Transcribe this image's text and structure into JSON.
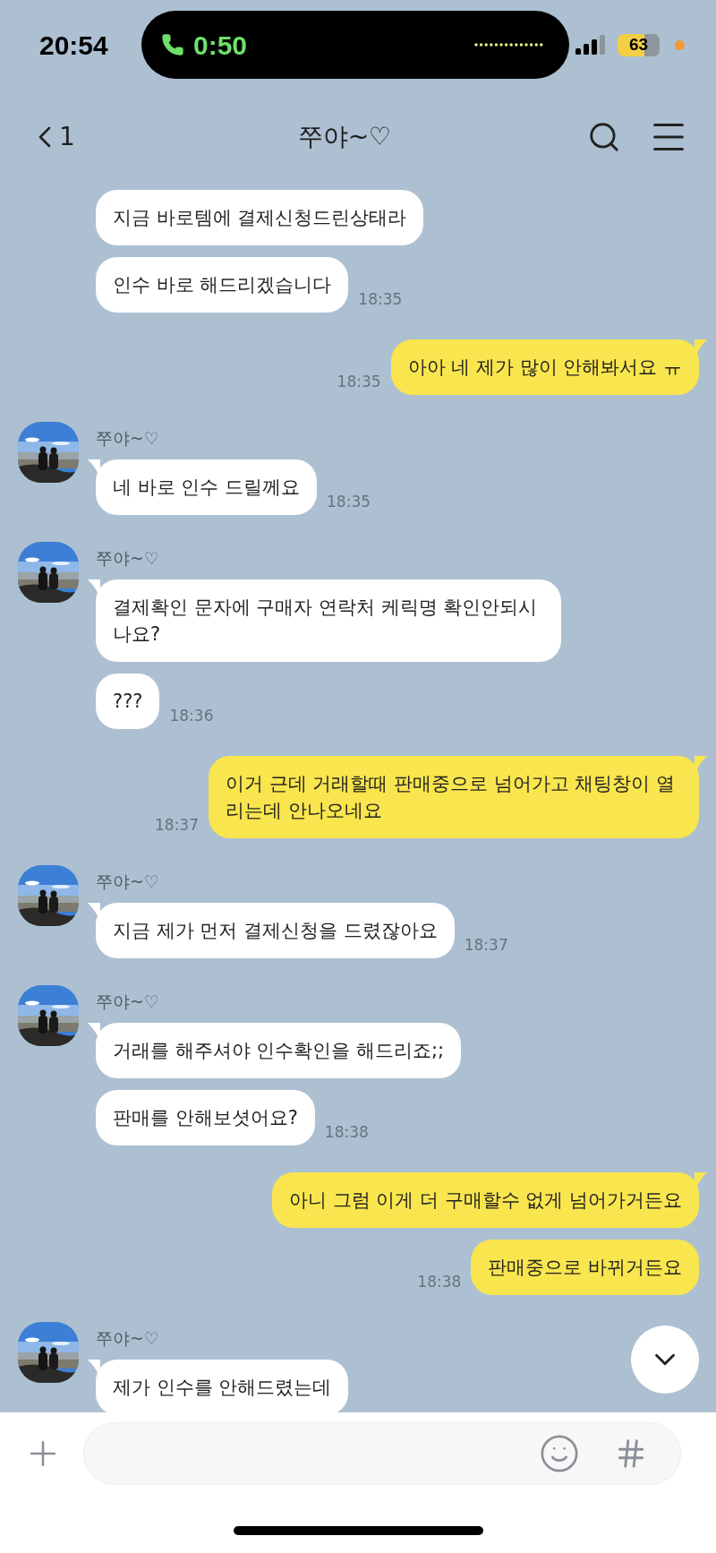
{
  "status_bar": {
    "time": "20:54",
    "call_timer": "0:50",
    "battery": "63"
  },
  "header": {
    "back_count": "1",
    "title": "쭈야~♡"
  },
  "messages": [
    {
      "kind": "received",
      "text": "지금 바로템에 결제신청드린상태라"
    },
    {
      "kind": "received",
      "text": "인수 바로 해드리겠습니다",
      "time": "18:35"
    },
    {
      "kind": "sent",
      "text": "아아 네 제가 많이 안해봐서요 ㅠ",
      "time": "18:35"
    },
    {
      "kind": "received",
      "name": "쭈야~♡",
      "text": "네 바로 인수 드릴께요",
      "time": "18:35"
    },
    {
      "kind": "received",
      "name": "쭈야~♡",
      "text": "결제확인 문자에 구매자 연락처 케릭명 확인안되시나요?"
    },
    {
      "kind": "received",
      "text": "???",
      "time": "18:36"
    },
    {
      "kind": "sent",
      "text": "이거 근데 거래할때 판매중으로 넘어가고 채팅창이 열리는데 안나오네요",
      "time": "18:37"
    },
    {
      "kind": "received",
      "name": "쭈야~♡",
      "text": "지금 제가 먼저 결제신청을 드렸잖아요",
      "time": "18:37"
    },
    {
      "kind": "received",
      "name": "쭈야~♡",
      "text": "거래를 해주셔야 인수확인을 해드리죠;;"
    },
    {
      "kind": "received",
      "text": "판매를 안해보셧어요?",
      "time": "18:38"
    },
    {
      "kind": "sent",
      "text": "아니 그럼 이게 더 구매할수 없게 넘어가거든요"
    },
    {
      "kind": "sent",
      "text": "판매중으로 바뀌거든요",
      "time": "18:38"
    },
    {
      "kind": "received",
      "name": "쭈야~♡",
      "text": "제가 인수를 안해드렸는데"
    }
  ]
}
